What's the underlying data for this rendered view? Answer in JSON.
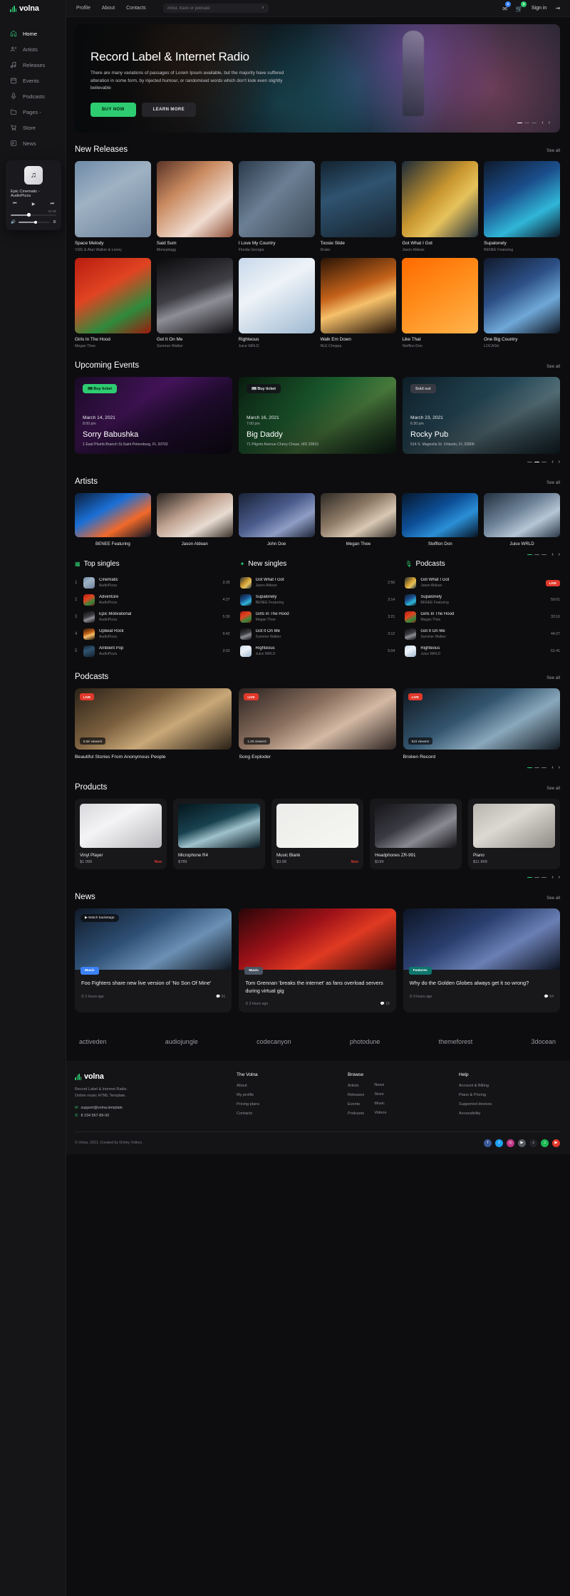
{
  "brand": {
    "name": "volna"
  },
  "sidebar": {
    "items": [
      {
        "label": "Home",
        "icon": "home-icon",
        "active": true
      },
      {
        "label": "Artists",
        "icon": "users-icon",
        "active": false
      },
      {
        "label": "Releases",
        "icon": "music-note-icon",
        "active": false
      },
      {
        "label": "Events",
        "icon": "calendar-icon",
        "active": false
      },
      {
        "label": "Podcasts",
        "icon": "microphone-icon",
        "active": false
      },
      {
        "label": "Pages -",
        "icon": "folder-icon",
        "active": false
      },
      {
        "label": "Store",
        "icon": "cart-icon",
        "active": false
      },
      {
        "label": "News",
        "icon": "newspaper-icon",
        "active": false
      }
    ]
  },
  "player": {
    "title": "Epic Cinematic - AudioPizza",
    "time": "02:35",
    "prev_icon": "previous-icon",
    "play_icon": "play-icon",
    "next_icon": "next-icon",
    "volume_icon": "volume-icon",
    "settings_icon": "equalizer-icon"
  },
  "topbar": {
    "nav": [
      "Profile",
      "About",
      "Contacts"
    ],
    "search_placeholder": "Artist, track or podcast",
    "search_icon": "search-icon",
    "mail_icon": "mail-icon",
    "mail_badge": "2",
    "cart_icon": "cart-icon",
    "cart_badge": "3",
    "signin_label": "Sign in",
    "signin_icon": "login-icon"
  },
  "hero": {
    "title": "Record Label & Internet Radio",
    "text": "There are many variations of passages of Lorem Ipsum available, but the majority have suffered alteration in some form, by injected humour, or randomised words which don't look even slightly believable",
    "primary_btn": "BUY NOW",
    "secondary_btn": "LEARN MORE",
    "prev_icon": "arrow-left-icon",
    "next_icon": "arrow-right-icon"
  },
  "releases": {
    "title": "New Releases",
    "see_all": "See all",
    "items": [
      {
        "title": "Space Melody",
        "artist": "VIZE & Alan Walker & Leony",
        "art": "a1"
      },
      {
        "title": "Said Sum",
        "artist": "Moneybagg",
        "art": "a2"
      },
      {
        "title": "I Love My Country",
        "artist": "Florida Georgia",
        "art": "a3"
      },
      {
        "title": "Toosie Slide",
        "artist": "Drake",
        "art": "a4"
      },
      {
        "title": "Got What I Got",
        "artist": "Jason Aldean",
        "art": "a5"
      },
      {
        "title": "Supalonely",
        "artist": "BENEE Featuring",
        "art": "a6"
      },
      {
        "title": "Girls In The Hood",
        "artist": "Megan Thee",
        "art": "a7"
      },
      {
        "title": "Got It On Me",
        "artist": "Summer Walker",
        "art": "a8"
      },
      {
        "title": "Righteous",
        "artist": "Juice WRLD",
        "art": "a9"
      },
      {
        "title": "Walk Em Down",
        "artist": "NLE Choppa",
        "art": "a10"
      },
      {
        "title": "Like That",
        "artist": "Stefflon Don",
        "art": "a11"
      },
      {
        "title": "One Big Country",
        "artist": "LOCASH",
        "art": "a12"
      }
    ]
  },
  "events": {
    "title": "Upcoming Events",
    "see_all": "See all",
    "items": [
      {
        "tag": "Buy ticket",
        "tag_style": "tag-green",
        "date": "March 14, 2021",
        "time": "8:00 pm",
        "name": "Sorry Babushka",
        "address": "1 East Plumb Branch St.Saint Petersburg, FL 33702",
        "art": "ev1"
      },
      {
        "tag": "Buy ticket",
        "tag_style": "tag-dark",
        "date": "March 16, 2021",
        "time": "7:00 pm",
        "name": "Big Daddy",
        "address": "71 Pilgrim Avenue Chevy Chase, MD 20815",
        "art": "ev2"
      },
      {
        "tag": "Sold out",
        "tag_style": "tag-grey",
        "date": "March 23, 2021",
        "time": "6:30 pm",
        "name": "Rocky Pub",
        "address": "514 S. Magnolia St. Orlando, FL 32806",
        "art": "ev3"
      }
    ]
  },
  "artists": {
    "title": "Artists",
    "see_all": "See all",
    "items": [
      {
        "name": "BENEE Featuring",
        "art": "r1"
      },
      {
        "name": "Jason Aldean",
        "art": "r2"
      },
      {
        "name": "John Doe",
        "art": "r3"
      },
      {
        "name": "Megan Thee",
        "art": "r4"
      },
      {
        "name": "Stefflon Don",
        "art": "r5"
      },
      {
        "name": "Juice WRLD",
        "art": "r6"
      }
    ]
  },
  "top_singles": {
    "title": "Top singles",
    "icon": "chart-icon",
    "items": [
      {
        "num": "1",
        "title": "Cinematic",
        "artist": "AudioPizza",
        "duration": "3:35",
        "art": "a1"
      },
      {
        "num": "2",
        "title": "Adventure",
        "artist": "AudioPizza",
        "duration": "4:37",
        "art": "a7"
      },
      {
        "num": "3",
        "title": "Epic Motivational",
        "artist": "AudioPizza",
        "duration": "5:30",
        "art": "a8"
      },
      {
        "num": "4",
        "title": "Upbeat Rock",
        "artist": "AudioPizza",
        "duration": "9:42",
        "art": "a10"
      },
      {
        "num": "5",
        "title": "Ambient Pop",
        "artist": "AudioPizza",
        "duration": "3:02",
        "art": "a4"
      }
    ]
  },
  "new_singles": {
    "title": "New singles",
    "icon": "sparkle-icon",
    "items": [
      {
        "title": "Got What I Got",
        "artist": "Jason Aldean",
        "duration": "2:56",
        "art": "a5"
      },
      {
        "title": "Supalonely",
        "artist": "BENEE Featuring",
        "duration": "3:14",
        "art": "a6"
      },
      {
        "title": "Girls In The Hood",
        "artist": "Megan Thee",
        "duration": "3:21",
        "art": "a7"
      },
      {
        "title": "Got It On Me",
        "artist": "Summer Walker",
        "duration": "3:12",
        "art": "a8"
      },
      {
        "title": "Righteous",
        "artist": "Juice WRLD",
        "duration": "5:04",
        "art": "a9"
      }
    ]
  },
  "podcasts_list": {
    "title": "Podcasts",
    "icon": "microphone-icon",
    "items": [
      {
        "title": "Got What I Got",
        "artist": "Jason Aldean",
        "duration": "LIVE",
        "live": true,
        "art": "a5"
      },
      {
        "title": "Supalonely",
        "artist": "BENEE Featuring",
        "duration": "59:01",
        "live": false,
        "art": "a6"
      },
      {
        "title": "Girls In The Hood",
        "artist": "Megan Thee",
        "duration": "33:16",
        "live": false,
        "art": "a7"
      },
      {
        "title": "Got It On Me",
        "artist": "Summer Walker",
        "duration": "44:27",
        "live": false,
        "art": "a8"
      },
      {
        "title": "Righteous",
        "artist": "Juice WRLD",
        "duration": "51:41",
        "live": false,
        "art": "a9"
      }
    ]
  },
  "podcasts": {
    "title": "Podcasts",
    "see_all": "See all",
    "items": [
      {
        "title": "Beautiful Stories From Anonymous People",
        "badge": "LIVE",
        "views": "6.5K viewers",
        "art": "p1"
      },
      {
        "title": "Song Exploder",
        "badge": "LIVE",
        "views": "1.2K viewers",
        "art": "p2"
      },
      {
        "title": "Broken Record",
        "badge": "LIVE",
        "views": "824 viewers",
        "art": "p3"
      }
    ]
  },
  "products": {
    "title": "Products",
    "see_all": "See all",
    "items": [
      {
        "title": "Vinyl Player",
        "price": "$1 099",
        "flag": "New",
        "art": "q1"
      },
      {
        "title": "Microphone R4",
        "price": "$789",
        "flag": "",
        "art": "q2"
      },
      {
        "title": "Music Blank",
        "price": "$3.99",
        "flag": "New",
        "art": "q3"
      },
      {
        "title": "Headphones ZR-991",
        "price": "$199",
        "flag": "",
        "art": "q4"
      },
      {
        "title": "Piano",
        "price": "$11 899",
        "flag": "",
        "art": "q5"
      }
    ]
  },
  "news": {
    "title": "News",
    "see_all": "See all",
    "items": [
      {
        "title": "Foo Fighters share new live version of 'No Son Of Mine'",
        "category": "Music",
        "cat_style": "cat-blue",
        "time": "2 hours ago",
        "comments": "81",
        "watch": "Watch backstage",
        "art": "n1"
      },
      {
        "title": "Tom Grennan 'breaks the internet' as fans overload servers during virtual gig",
        "category": "Music",
        "cat_style": "cat-slate",
        "time": "3 hours ago",
        "comments": "18",
        "watch": "",
        "art": "n2"
      },
      {
        "title": "Why do the Golden Globes always get it so wrong?",
        "category": "Features",
        "cat_style": "cat-teal",
        "time": "9 hours ago",
        "comments": "54",
        "watch": "",
        "art": "n3"
      }
    ]
  },
  "partners": [
    "activeden",
    "audiojungle",
    "codecanyon",
    "photodune",
    "themeforest",
    "3docean"
  ],
  "footer": {
    "brand": "volna",
    "desc": "Record Label & Internet Radio.\nOnline music HTML Template.",
    "email": "support@volna.template",
    "email_icon": "mail-icon",
    "phone": "8 234 567-89-00",
    "phone_icon": "phone-icon",
    "columns": [
      {
        "heading": "The Volna",
        "links": [
          "About",
          "My profile",
          "Pricing plans",
          "Contacts"
        ]
      },
      {
        "heading": "Browse",
        "links": [
          "Artists",
          "Releases",
          "Events",
          "Podcasts"
        ]
      },
      {
        "heading": "",
        "links": [
          "News",
          "Store",
          "Music",
          "Videos"
        ]
      },
      {
        "heading": "Help",
        "links": [
          "Account & Billing",
          "Plans & Pricing",
          "Supported devices",
          "Accessibility"
        ]
      }
    ],
    "copyright": "© Volna, 2021. Created by Dmitry Volkov.",
    "socials": [
      {
        "name": "facebook-icon",
        "glyph": "f",
        "color": "#3b5998"
      },
      {
        "name": "twitter-icon",
        "glyph": "t",
        "color": "#1da1f2"
      },
      {
        "name": "instagram-icon",
        "glyph": "◎",
        "color": "#c13584"
      },
      {
        "name": "youtube-icon",
        "glyph": "▶",
        "color": "#555a60"
      },
      {
        "name": "tiktok-icon",
        "glyph": "♪",
        "color": "#222228"
      },
      {
        "name": "spotify-icon",
        "glyph": "♫",
        "color": "#1db954"
      },
      {
        "name": "rss-icon",
        "glyph": "▶",
        "color": "#e0392b"
      }
    ]
  }
}
